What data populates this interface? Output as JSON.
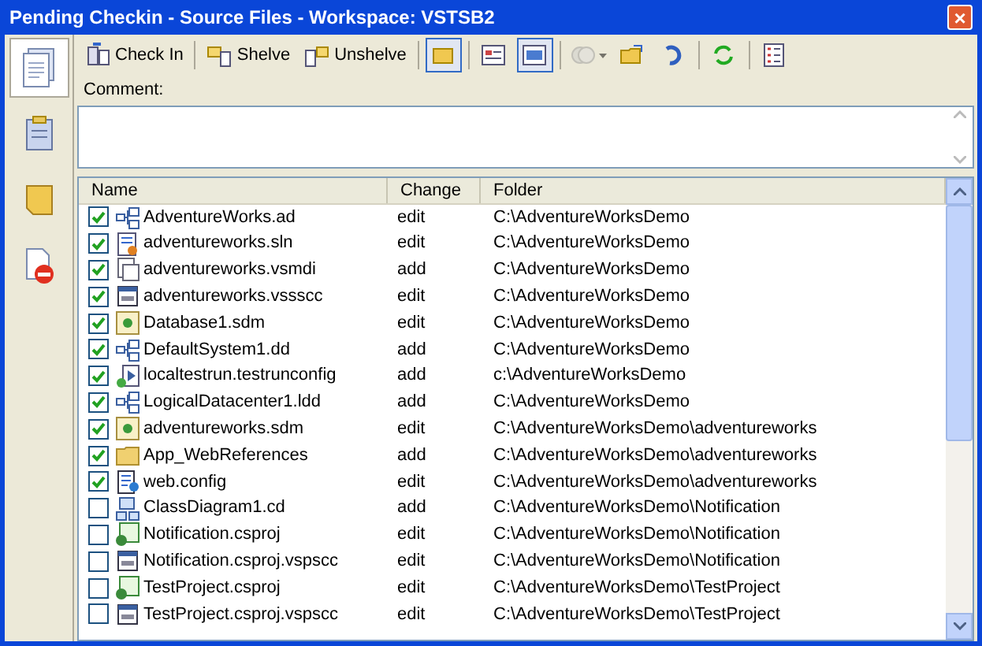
{
  "window": {
    "title": "Pending Checkin - Source Files - Workspace: VSTSB2",
    "close": "×"
  },
  "sidebar": {
    "items": [
      {
        "kind": "files",
        "selected": true
      },
      {
        "kind": "workitems",
        "selected": false
      },
      {
        "kind": "notes",
        "selected": false
      },
      {
        "kind": "policy",
        "selected": false
      }
    ]
  },
  "toolbar": [
    {
      "kind": "text",
      "label": "Check In"
    },
    {
      "kind": "separator"
    },
    {
      "kind": "text",
      "label": "Shelve"
    },
    {
      "kind": "text",
      "label": "Unshelve"
    },
    {
      "kind": "separator"
    },
    {
      "kind": "toggle",
      "selected": true
    },
    {
      "kind": "separator"
    },
    {
      "kind": "toggle",
      "selected": false
    },
    {
      "kind": "toggle",
      "selected": true
    },
    {
      "kind": "separator"
    },
    {
      "kind": "dropdown",
      "disabled": true
    },
    {
      "kind": "icon"
    },
    {
      "kind": "icon"
    },
    {
      "kind": "separator"
    },
    {
      "kind": "icon"
    },
    {
      "kind": "separator"
    },
    {
      "kind": "icon"
    }
  ],
  "comment": {
    "label": "Comment:"
  },
  "table": {
    "columns": [
      "Name",
      "Change",
      "Folder"
    ],
    "rows": [
      {
        "checked": true,
        "kind": "diagram",
        "name": "AdventureWorks.ad",
        "change": "edit",
        "folder": "C:\\AdventureWorksDemo"
      },
      {
        "checked": true,
        "kind": "solution",
        "name": "adventureworks.sln",
        "change": "edit",
        "folder": "C:\\AdventureWorksDemo"
      },
      {
        "checked": true,
        "kind": "file",
        "name": "adventureworks.vsmdi",
        "change": "add",
        "folder": "C:\\AdventureWorksDemo"
      },
      {
        "checked": true,
        "kind": "scc",
        "name": "adventureworks.vssscc",
        "change": "edit",
        "folder": "C:\\AdventureWorksDemo"
      },
      {
        "checked": true,
        "kind": "sdm",
        "name": "Database1.sdm",
        "change": "edit",
        "folder": "C:\\AdventureWorksDemo"
      },
      {
        "checked": true,
        "kind": "diagram",
        "name": "DefaultSystem1.dd",
        "change": "add",
        "folder": "C:\\AdventureWorksDemo"
      },
      {
        "checked": true,
        "kind": "test",
        "name": "localtestrun.testrunconfig",
        "change": "add",
        "folder": "c:\\AdventureWorksDemo"
      },
      {
        "checked": true,
        "kind": "diagram",
        "name": "LogicalDatacenter1.ldd",
        "change": "add",
        "folder": "C:\\AdventureWorksDemo"
      },
      {
        "checked": true,
        "kind": "sdm",
        "name": "adventureworks.sdm",
        "change": "edit",
        "folder": "C:\\AdventureWorksDemo\\adventureworks"
      },
      {
        "checked": true,
        "kind": "folder",
        "name": "App_WebReferences",
        "change": "add",
        "folder": "C:\\AdventureWorksDemo\\adventureworks"
      },
      {
        "checked": true,
        "kind": "config",
        "name": "web.config",
        "change": "edit",
        "folder": "C:\\AdventureWorksDemo\\adventureworks"
      },
      {
        "checked": false,
        "kind": "class",
        "name": "ClassDiagram1.cd",
        "change": "add",
        "folder": "C:\\AdventureWorksDemo\\Notification"
      },
      {
        "checked": false,
        "kind": "csproj",
        "name": "Notification.csproj",
        "change": "edit",
        "folder": "C:\\AdventureWorksDemo\\Notification"
      },
      {
        "checked": false,
        "kind": "scc",
        "name": "Notification.csproj.vspscc",
        "change": "edit",
        "folder": "C:\\AdventureWorksDemo\\Notification"
      },
      {
        "checked": false,
        "kind": "csproj",
        "name": "TestProject.csproj",
        "change": "edit",
        "folder": "C:\\AdventureWorksDemo\\TestProject"
      },
      {
        "checked": false,
        "kind": "scc",
        "name": "TestProject.csproj.vspscc",
        "change": "edit",
        "folder": "C:\\AdventureWorksDemo\\TestProject"
      }
    ]
  }
}
